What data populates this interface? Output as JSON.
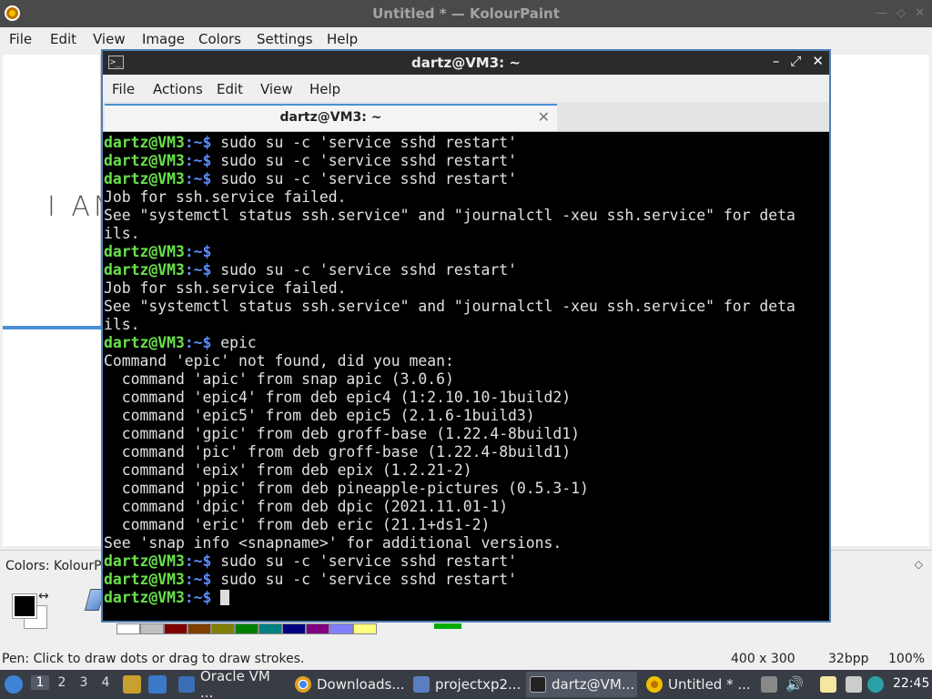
{
  "kolourpaint": {
    "title": "Untitled * — KolourPaint",
    "menu": [
      "File",
      "Edit",
      "View",
      "Image",
      "Colors",
      "Settings",
      "Help"
    ],
    "canvas_text": "I AN",
    "colors_label": "Colors: KolourP",
    "palette": [
      "#ffffff",
      "#c0c0c0",
      "#800000",
      "#804000",
      "#808000",
      "#008000",
      "#008080",
      "#000080",
      "#800080",
      "#8080ff",
      "#ffff80"
    ],
    "status": {
      "hint": "Pen: Click to draw dots or drag to draw strokes.",
      "size": "400 x 300",
      "bpp": "32bpp",
      "zoom": "100%"
    }
  },
  "terminal": {
    "title": "dartz@VM3: ~",
    "menu": [
      "File",
      "Actions",
      "Edit",
      "View",
      "Help"
    ],
    "tab_label": "dartz@VM3: ~",
    "prompt_user": "dartz@VM3",
    "prompt_path": ":~$",
    "lines": [
      {
        "type": "cmd",
        "text": " sudo su -c 'service sshd restart'"
      },
      {
        "type": "cmd",
        "text": " sudo su -c 'service sshd restart'"
      },
      {
        "type": "cmd",
        "text": " sudo su -c 'service sshd restart'"
      },
      {
        "type": "out",
        "text": "Job for ssh.service failed."
      },
      {
        "type": "out",
        "text": "See \"systemctl status ssh.service\" and \"journalctl -xeu ssh.service\" for deta"
      },
      {
        "type": "out",
        "text": "ils."
      },
      {
        "type": "cmd",
        "text": ""
      },
      {
        "type": "cmd",
        "text": " sudo su -c 'service sshd restart'"
      },
      {
        "type": "out",
        "text": "Job for ssh.service failed."
      },
      {
        "type": "out",
        "text": "See \"systemctl status ssh.service\" and \"journalctl -xeu ssh.service\" for deta"
      },
      {
        "type": "out",
        "text": "ils."
      },
      {
        "type": "cmd",
        "text": " epic"
      },
      {
        "type": "out",
        "text": "Command 'epic' not found, did you mean:"
      },
      {
        "type": "out",
        "text": "  command 'apic' from snap apic (3.0.6)"
      },
      {
        "type": "out",
        "text": "  command 'epic4' from deb epic4 (1:2.10.10-1build2)"
      },
      {
        "type": "out",
        "text": "  command 'epic5' from deb epic5 (2.1.6-1build3)"
      },
      {
        "type": "out",
        "text": "  command 'gpic' from deb groff-base (1.22.4-8build1)"
      },
      {
        "type": "out",
        "text": "  command 'pic' from deb groff-base (1.22.4-8build1)"
      },
      {
        "type": "out",
        "text": "  command 'epix' from deb epix (1.2.21-2)"
      },
      {
        "type": "out",
        "text": "  command 'ppic' from deb pineapple-pictures (0.5.3-1)"
      },
      {
        "type": "out",
        "text": "  command 'dpic' from deb dpic (2021.11.01-1)"
      },
      {
        "type": "out",
        "text": "  command 'eric' from deb eric (21.1+ds1-2)"
      },
      {
        "type": "out",
        "text": "See 'snap info <snapname>' for additional versions."
      },
      {
        "type": "cmd",
        "text": " sudo su -c 'service sshd restart'"
      },
      {
        "type": "cmd",
        "text": " sudo su -c 'service sshd restart'"
      },
      {
        "type": "cursor",
        "text": " "
      }
    ]
  },
  "taskbar": {
    "workspaces": [
      "1",
      "2",
      "3",
      "4"
    ],
    "tasks": [
      {
        "label": "Oracle VM ...",
        "icon": "virtualbox-icon",
        "color": "#3a6fb5"
      },
      {
        "label": "Downloads...",
        "icon": "chrome-icon",
        "color": "#e0a020"
      },
      {
        "label": "projectxp2...",
        "icon": "app-icon",
        "color": "#5a7ec0"
      },
      {
        "label": "dartz@VM...",
        "icon": "terminal-icon",
        "color": "#333333"
      },
      {
        "label": "Untitled * ...",
        "icon": "kolourpaint-icon",
        "color": "#f0c000"
      }
    ],
    "clock": "22:45"
  }
}
